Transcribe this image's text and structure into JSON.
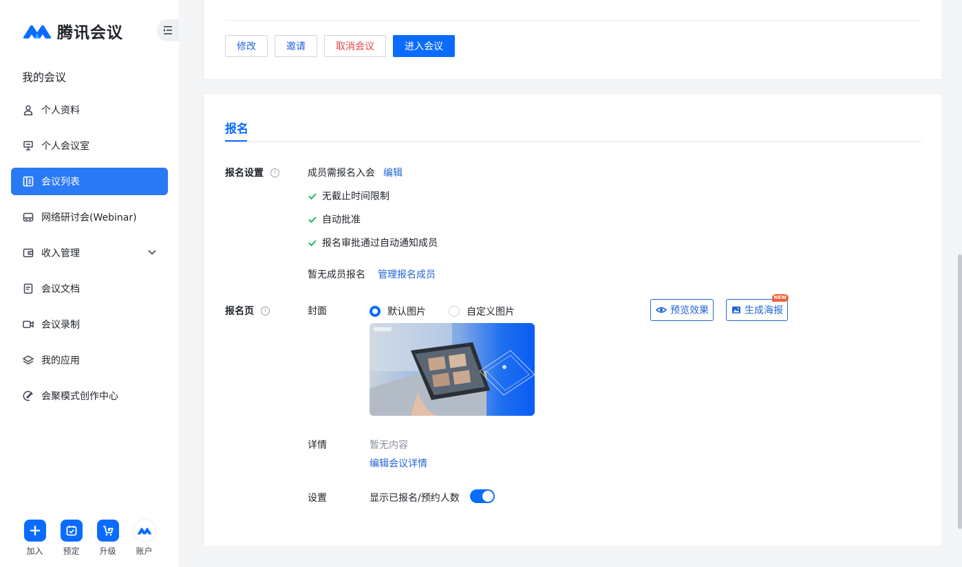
{
  "brand": {
    "name": "腾讯会议",
    "accent": "#0a6cff"
  },
  "sidebar": {
    "section_title": "我的会议",
    "items": [
      {
        "label": "个人资料",
        "icon": "user-icon"
      },
      {
        "label": "个人会议室",
        "icon": "room-icon"
      },
      {
        "label": "会议列表",
        "icon": "meeting-list-icon",
        "active": true
      },
      {
        "label": "网络研讨会(Webinar)",
        "icon": "webinar-icon"
      },
      {
        "label": "收入管理",
        "icon": "wallet-icon",
        "expandable": true
      },
      {
        "label": "会议文档",
        "icon": "document-icon"
      },
      {
        "label": "会议录制",
        "icon": "video-icon"
      },
      {
        "label": "我的应用",
        "icon": "layers-icon"
      },
      {
        "label": "会聚模式创作中心",
        "icon": "palette-icon"
      }
    ],
    "bottom": [
      {
        "label": "加入",
        "icon": "plus-icon"
      },
      {
        "label": "预定",
        "icon": "calendar-check-icon"
      },
      {
        "label": "升级",
        "icon": "cart-icon"
      },
      {
        "label": "账户",
        "icon": "account-avatar-icon"
      }
    ]
  },
  "actions": {
    "edit": "修改",
    "invite": "邀请",
    "cancel": "取消会议",
    "enter": "进入会议"
  },
  "registration": {
    "tab": "报名",
    "settings_label": "报名设置",
    "requirement": "成员需报名入会",
    "edit_link": "编辑",
    "checks": [
      "无截止时间限制",
      "自动批准",
      "报名审批通过自动通知成员"
    ],
    "no_members": "暂无成员报名",
    "manage_link": "管理报名成员",
    "page_label": "报名页",
    "cover_label": "封面",
    "cover_options": {
      "default": "默认图片",
      "custom": "自定义图片",
      "selected": "default"
    },
    "preview_button": "预览效果",
    "poster_button": "生成海报",
    "new_badge": "NEW",
    "detail_label": "详情",
    "detail_empty": "暂无内容",
    "detail_edit_link": "编辑会议详情",
    "setting_label": "设置",
    "show_count_label": "显示已报名/预约人数",
    "show_count_enabled": true
  }
}
